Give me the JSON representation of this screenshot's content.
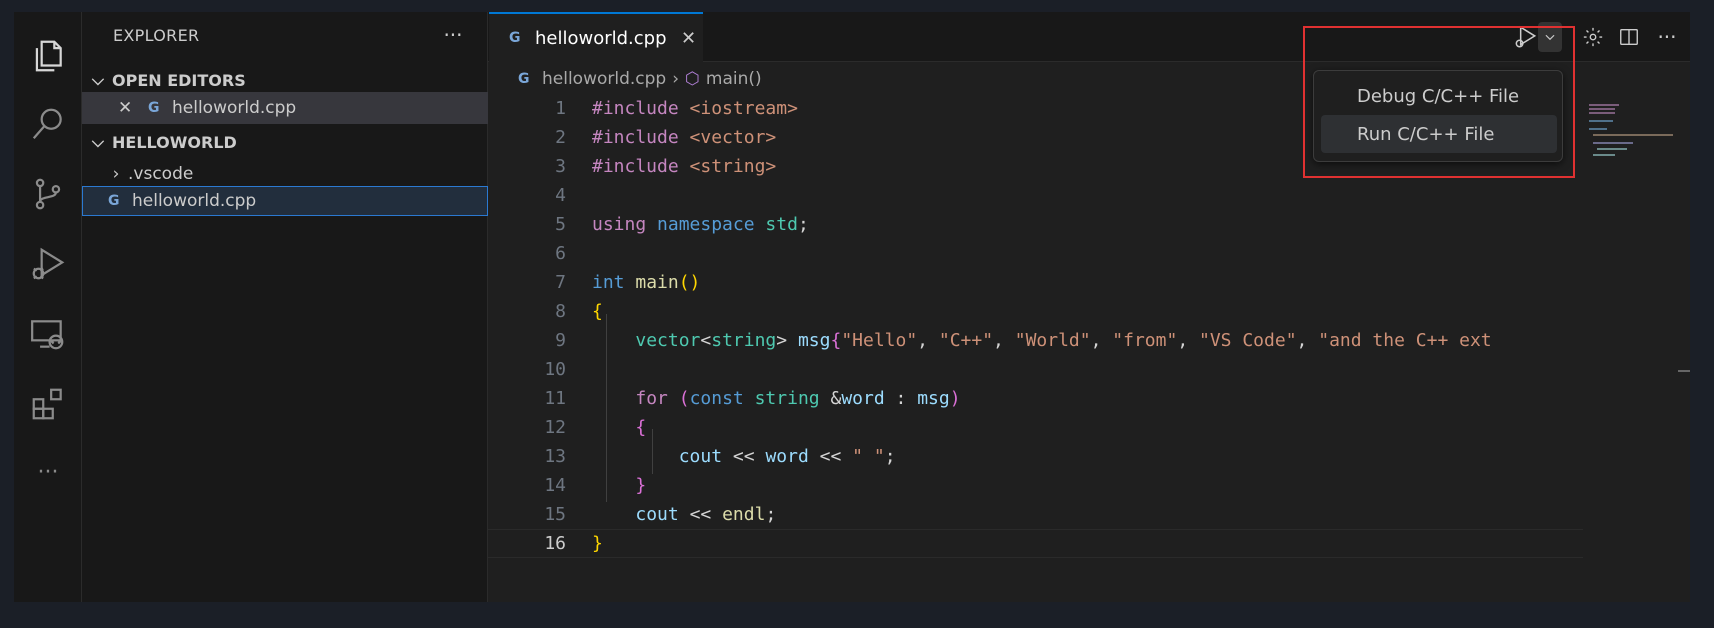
{
  "explorer": {
    "title": "EXPLORER",
    "more": "···",
    "open_editors_label": "OPEN EDITORS",
    "open_editor_file": "helloworld.cpp",
    "folder_label": "HELLOWORLD",
    "vscode_folder": ".vscode",
    "file": "helloworld.cpp"
  },
  "tab": {
    "label": "helloworld.cpp",
    "close": "✕"
  },
  "breadcrumb": {
    "file": "helloworld.cpp",
    "symbol": "main()"
  },
  "menu": {
    "items": [
      "Debug C/C++ File",
      "Run C/C++ File"
    ]
  },
  "toolbar": {
    "more": "···"
  },
  "code": {
    "line_numbers": [
      "1",
      "2",
      "3",
      "4",
      "5",
      "6",
      "7",
      "8",
      "9",
      "10",
      "11",
      "12",
      "13",
      "14",
      "15",
      "16"
    ]
  },
  "colors": {
    "accent": "#0078d4",
    "highlight": "#e03131"
  }
}
